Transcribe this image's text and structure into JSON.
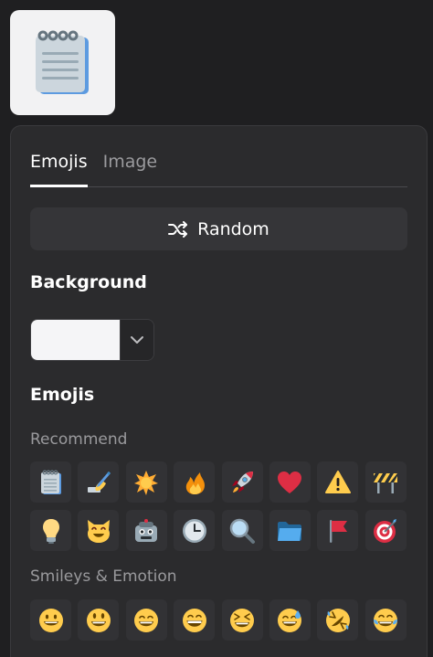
{
  "tabs": [
    {
      "label": "Emojis",
      "active": true
    },
    {
      "label": "Image",
      "active": false
    }
  ],
  "random_button": {
    "label": "Random",
    "icon": "shuffle-icon"
  },
  "background": {
    "title": "Background",
    "selected_color": "#f5f5f7"
  },
  "emojis_section": {
    "title": "Emojis",
    "groups": [
      {
        "label": "Recommend",
        "items": [
          "notepad",
          "writing-hand",
          "sun-burst",
          "fire",
          "rocket",
          "red-heart",
          "warning",
          "construction",
          "light-bulb",
          "smiling-cat",
          "robot",
          "clock",
          "magnifier",
          "folder",
          "red-flag",
          "target"
        ]
      },
      {
        "label": "Smileys & Emotion",
        "items": [
          "grinning-face",
          "smiley",
          "grin-smile",
          "big-grin",
          "squint-laugh",
          "sweat-smile",
          "rolling-laugh",
          "tears-of-joy"
        ]
      }
    ]
  }
}
